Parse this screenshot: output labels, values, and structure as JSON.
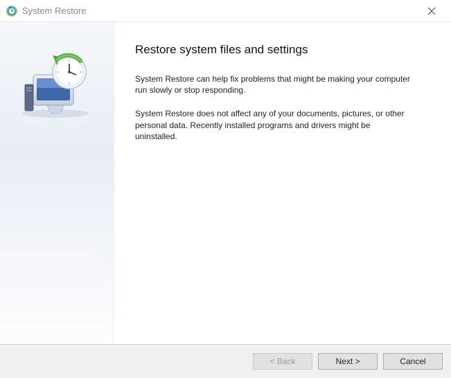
{
  "titlebar": {
    "title": "System Restore"
  },
  "main": {
    "heading": "Restore system files and settings",
    "para1": "System Restore can help fix problems that might be making your computer run slowly or stop responding.",
    "para2": "System Restore does not affect any of your documents, pictures, or other personal data. Recently installed programs and drivers might be uninstalled."
  },
  "footer": {
    "back": "< Back",
    "next": "Next >",
    "cancel": "Cancel"
  }
}
